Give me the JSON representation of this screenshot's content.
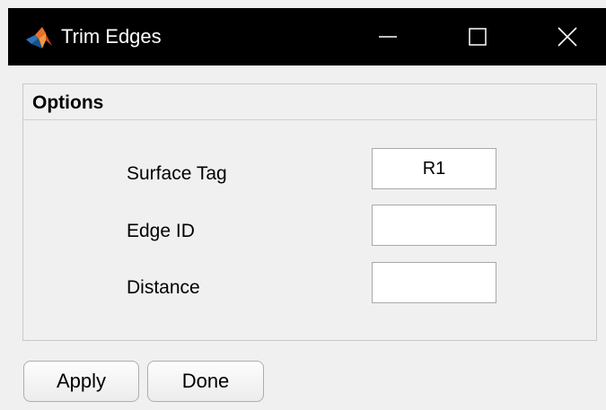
{
  "window": {
    "title": "Trim Edges",
    "app_icon": "matlab-logo-icon",
    "controls": {
      "minimize_icon": "minimize-icon",
      "maximize_icon": "maximize-icon",
      "close_icon": "close-icon"
    }
  },
  "options": {
    "title": "Options",
    "fields": [
      {
        "label": "Surface Tag",
        "value": "R1"
      },
      {
        "label": "Edge ID",
        "value": ""
      },
      {
        "label": "Distance",
        "value": ""
      }
    ]
  },
  "buttons": {
    "apply_label": "Apply",
    "done_label": "Done"
  },
  "colors": {
    "titlebar_bg": "#000000",
    "window_bg": "#f0f0f0",
    "logo_orange": "#e8712b",
    "logo_blue": "#1e6fb5"
  }
}
